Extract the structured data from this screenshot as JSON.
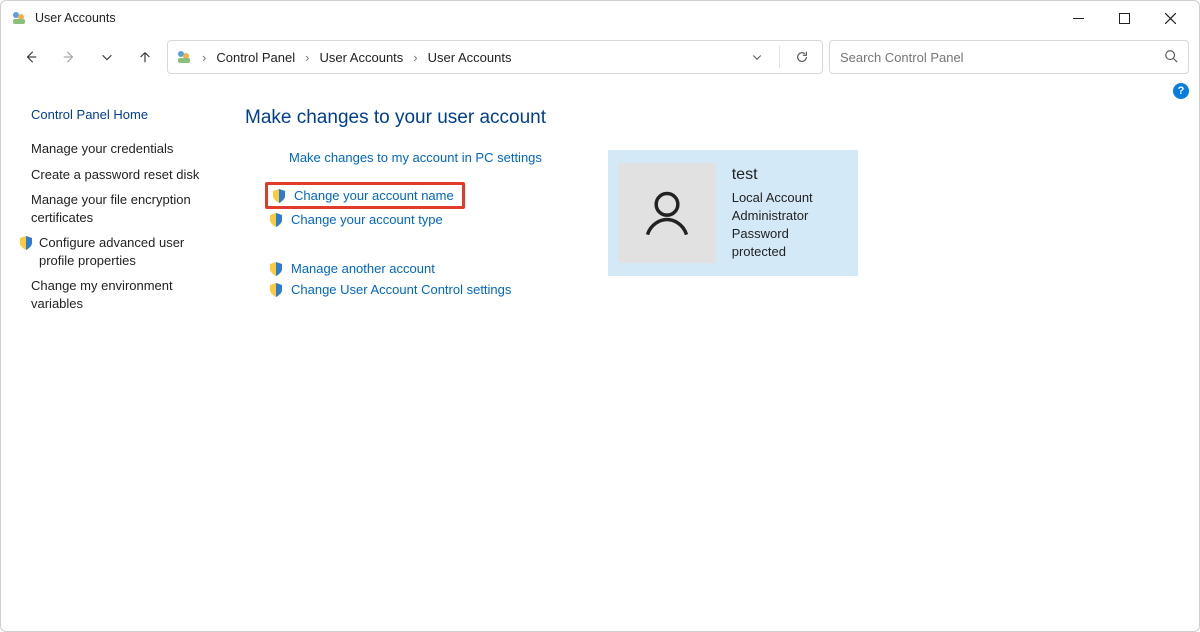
{
  "window": {
    "title": "User Accounts"
  },
  "breadcrumb": {
    "items": [
      "Control Panel",
      "User Accounts",
      "User Accounts"
    ]
  },
  "search": {
    "placeholder": "Search Control Panel"
  },
  "sidebar": {
    "heading": "Control Panel Home",
    "items": [
      {
        "label": "Manage your credentials",
        "shield": false
      },
      {
        "label": "Create a password reset disk",
        "shield": false
      },
      {
        "label": "Manage your file encryption certificates",
        "shield": false
      },
      {
        "label": "Configure advanced user profile properties",
        "shield": true
      },
      {
        "label": "Change my environment variables",
        "shield": false
      }
    ]
  },
  "main": {
    "heading": "Make changes to your user account",
    "group1": [
      {
        "label": "Make changes to my account in PC settings",
        "shield": false,
        "highlight": false
      },
      {
        "label": "Change your account name",
        "shield": true,
        "highlight": true
      },
      {
        "label": "Change your account type",
        "shield": true,
        "highlight": false
      }
    ],
    "group2": [
      {
        "label": "Manage another account",
        "shield": true
      },
      {
        "label": "Change User Account Control settings",
        "shield": true
      }
    ]
  },
  "account": {
    "name": "test",
    "type": "Local Account",
    "role": "Administrator",
    "protection": "Password protected"
  },
  "help": {
    "label": "?"
  }
}
